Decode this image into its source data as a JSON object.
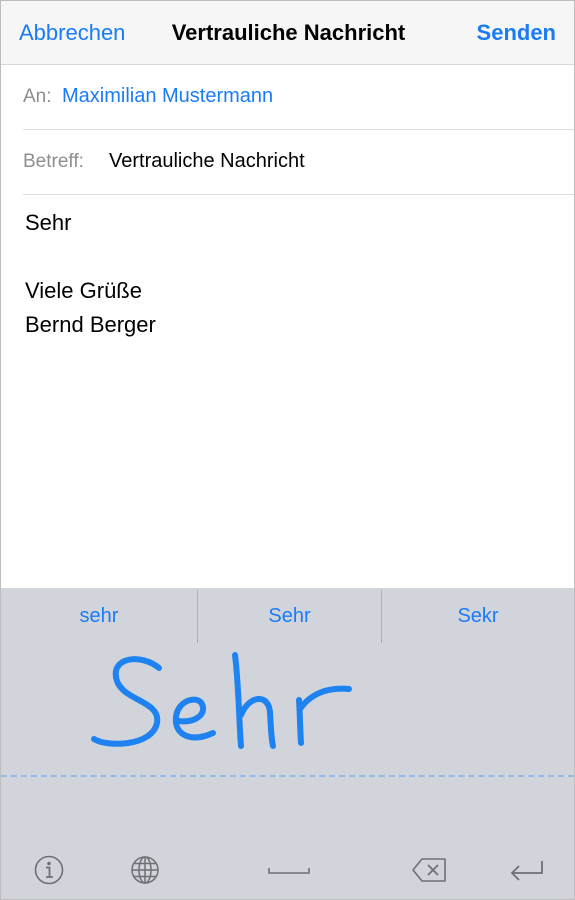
{
  "nav": {
    "cancel_label": "Abbrechen",
    "title": "Vertrauliche Nachricht",
    "send_label": "Senden"
  },
  "fields": {
    "to_label": "An:",
    "to_value": "Maximilian Mustermann",
    "subject_label": "Betreff:",
    "subject_value": "Vertrauliche Nachricht"
  },
  "body": {
    "lines": [
      "Sehr",
      "",
      "Viele Grüße",
      "Bernd Berger"
    ]
  },
  "keyboard": {
    "candidates": [
      "sehr",
      "Sehr",
      "Sekr"
    ],
    "handwriting_text": "Sehr",
    "keys": [
      "info-icon",
      "globe-icon",
      "space-icon",
      "delete-icon",
      "return-icon"
    ]
  },
  "colors": {
    "accent": "#1a7cf5",
    "ink": "#1e82f0",
    "keyboard_bg": "#d2d4dc"
  }
}
